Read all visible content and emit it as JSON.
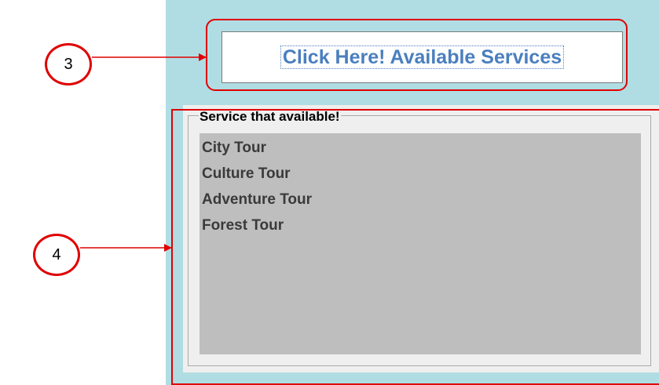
{
  "annotations": {
    "callout_3": "3",
    "callout_4": "4",
    "color": "#e00000"
  },
  "header": {
    "button_label": "Click Here! Available Services"
  },
  "services_panel": {
    "title": "Service that available!",
    "items": [
      {
        "label": "City Tour"
      },
      {
        "label": "Culture Tour"
      },
      {
        "label": "Adventure Tour"
      },
      {
        "label": "Forest Tour"
      }
    ]
  },
  "colors": {
    "app_background": "#b0dde3",
    "button_text": "#4a7fbf",
    "list_background": "#bebebe"
  }
}
